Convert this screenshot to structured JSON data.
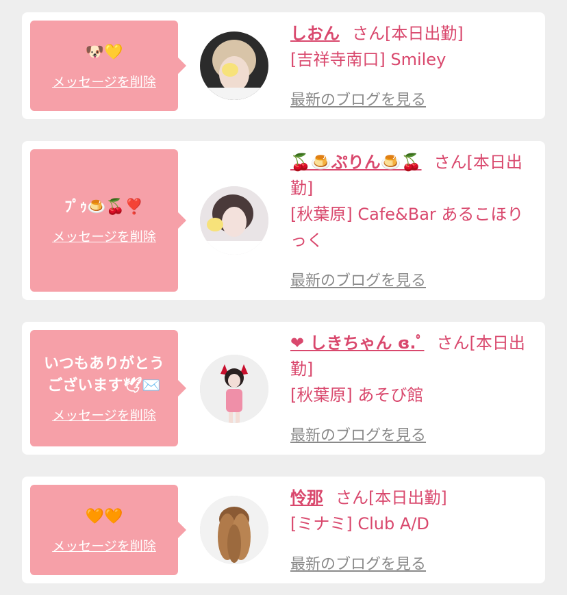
{
  "cards": [
    {
      "message": "🐶💛",
      "delete_label": "メッセージを削除",
      "name": "しおん",
      "san_status": "さん[本日出勤]",
      "location": "[吉祥寺南口] Smiley",
      "blog_link": "最新のブログを見る"
    },
    {
      "message": "ﾌﾟｩ🍮🍒❣️",
      "delete_label": "メッセージを削除",
      "name": "🍒🍮ぷりん🍮🍒",
      "san_status": "さん[本日出勤]",
      "location": "[秋葉原] Cafe&Bar あるこほりっく",
      "blog_link": "最新のブログを見る"
    },
    {
      "message_line1": "いつもありがとう",
      "message_line2": "ございます🕊✉️",
      "delete_label": "メッセージを削除",
      "name": "❤︎ しきちゃん ɞ.ﾟ",
      "san_status": "さん[本日出勤]",
      "location": "[秋葉原] あそび館",
      "blog_link": "最新のブログを見る"
    },
    {
      "message": "🧡🧡",
      "delete_label": "メッセージを削除",
      "name": "怜那",
      "san_status": "さん[本日出勤]",
      "location": "[ミナミ] Club A/D",
      "blog_link": "最新のブログを見る"
    }
  ],
  "colors": {
    "bubble": "#f6a0a8",
    "accent_text": "#d9486d",
    "muted_link": "#8a8a8a",
    "page_bg": "#eeeeee"
  }
}
